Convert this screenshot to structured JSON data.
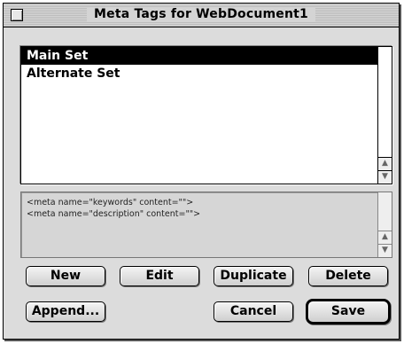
{
  "window": {
    "title": "Meta Tags for WebDocument1"
  },
  "tag_sets": {
    "items": [
      {
        "label": "Main Set",
        "selected": true
      },
      {
        "label": "Alternate Set",
        "selected": false
      }
    ]
  },
  "preview": {
    "lines": [
      "<meta name=\"keywords\" content=\"\">",
      "<meta name=\"description\" content=\"\">"
    ]
  },
  "buttons": {
    "new": "New",
    "edit": "Edit",
    "duplicate": "Duplicate",
    "delete": "Delete",
    "append": "Append...",
    "cancel": "Cancel",
    "save": "Save"
  },
  "icons": {
    "close": "close-box-icon",
    "scroll_up": "scroll-up-arrow-icon",
    "scroll_down": "scroll-down-arrow-icon"
  }
}
